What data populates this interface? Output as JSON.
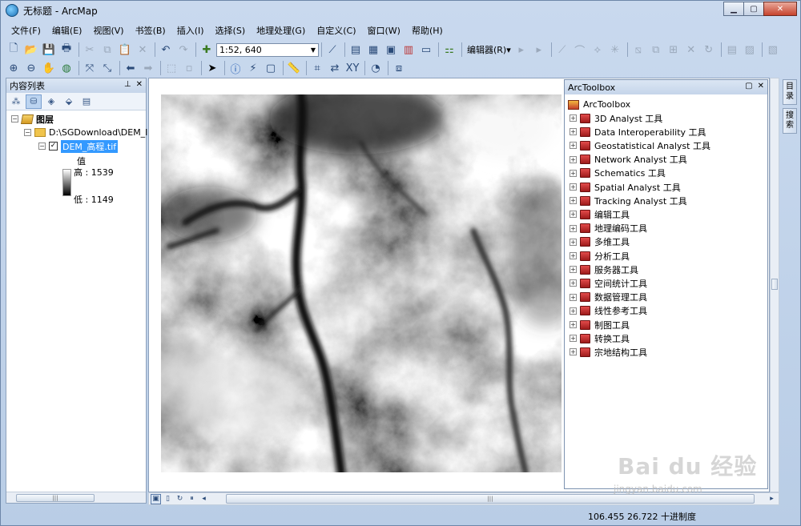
{
  "window": {
    "title": "无标题 - ArcMap",
    "minimize": "▁",
    "maximize": "▢",
    "close": "✕"
  },
  "menu": [
    "文件(F)",
    "编辑(E)",
    "视图(V)",
    "书签(B)",
    "插入(I)",
    "选择(S)",
    "地理处理(G)",
    "自定义(C)",
    "窗口(W)",
    "帮助(H)"
  ],
  "toolbar": {
    "scale_value": "1:52, 640",
    "editor_label": "编辑器(R)▾"
  },
  "toc": {
    "title": "内容列表",
    "layers_root": "图层",
    "folder_path": "D:\\SGDownload\\DEM_I",
    "layer_name": "DEM_高程.tif",
    "legend_title": "值",
    "legend_high": "高 : 1539",
    "legend_low": "低 : 1149"
  },
  "toolbox": {
    "title": "ArcToolbox",
    "root": "ArcToolbox",
    "items": [
      "3D Analyst 工具",
      "Data Interoperability 工具",
      "Geostatistical Analyst 工具",
      "Network Analyst 工具",
      "Schematics 工具",
      "Spatial Analyst 工具",
      "Tracking Analyst 工具",
      "编辑工具",
      "地理编码工具",
      "多维工具",
      "分析工具",
      "服务器工具",
      "空间统计工具",
      "数据管理工具",
      "线性参考工具",
      "制图工具",
      "转换工具",
      "宗地结构工具"
    ]
  },
  "side_tabs": [
    "目录",
    "搜索"
  ],
  "status": {
    "coordinates": "106.455  26.722 十进制度"
  },
  "watermark": {
    "main": "Bai du 经验",
    "sub": "jingyan.baidu.com"
  }
}
